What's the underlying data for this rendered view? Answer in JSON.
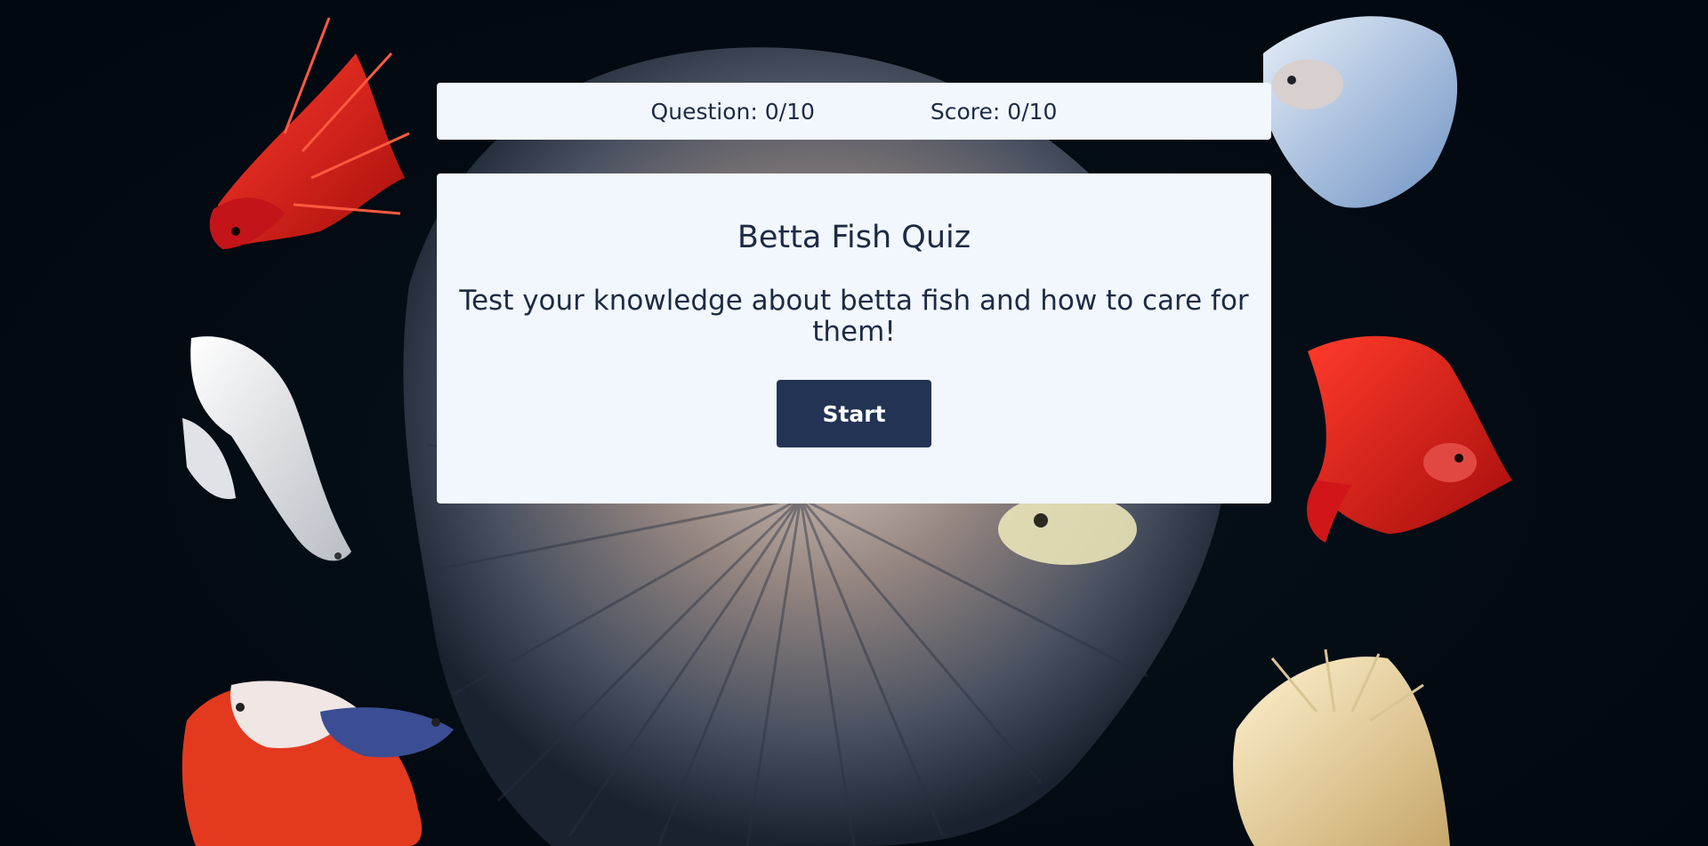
{
  "stats": {
    "question_label": "Question:",
    "question_value": "0/10",
    "score_label": "Score:",
    "score_value": "0/10"
  },
  "quiz": {
    "title": "Betta Fish Quiz",
    "description": "Test your knowledge about betta fish and how to care for them!",
    "start_label": "Start"
  },
  "colors": {
    "background": "#030c14",
    "panel": "#f1f7fd",
    "text": "#1e2a44",
    "button": "#223354",
    "button_text": "#ffffff"
  }
}
